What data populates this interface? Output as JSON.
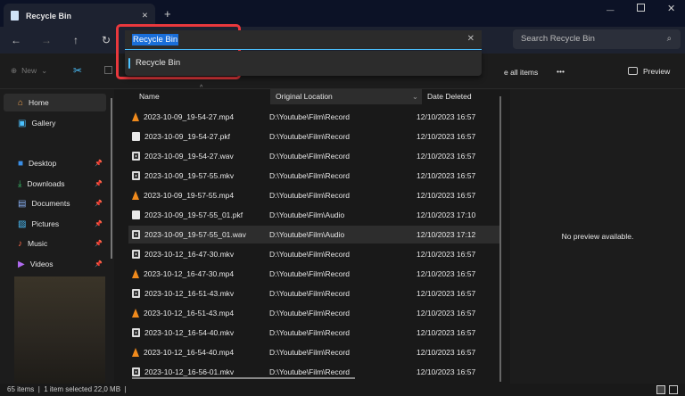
{
  "window": {
    "tab_title": "Recycle Bin",
    "new_tab": "+"
  },
  "address": {
    "value": "Recycle Bin",
    "suggestion": "Recycle Bin"
  },
  "search": {
    "placeholder": "Search Recycle Bin"
  },
  "toolbar": {
    "new_label": "New",
    "restore_all": "e all items",
    "more": "•••",
    "preview_label": "Preview"
  },
  "sidebar": {
    "items": [
      {
        "label": "Home",
        "icon": "home-icon",
        "pinned": false
      },
      {
        "label": "Gallery",
        "icon": "gallery-icon",
        "pinned": false
      },
      {
        "label": "Desktop",
        "icon": "desktop-icon",
        "pinned": true
      },
      {
        "label": "Downloads",
        "icon": "download-icon",
        "pinned": true
      },
      {
        "label": "Documents",
        "icon": "document-icon",
        "pinned": true
      },
      {
        "label": "Pictures",
        "icon": "pictures-icon",
        "pinned": true
      },
      {
        "label": "Music",
        "icon": "music-icon",
        "pinned": true
      },
      {
        "label": "Videos",
        "icon": "videos-icon",
        "pinned": true
      }
    ]
  },
  "columns": {
    "name": "Name",
    "location": "Original Location",
    "date": "Date Deleted"
  },
  "files": [
    {
      "name": "2023-10-09_19-54-27.mp4",
      "type": "vlc",
      "location": "D:\\Youtube\\Film\\Record",
      "date": "12/10/2023 16:57"
    },
    {
      "name": "2023-10-09_19-54-27.pkf",
      "type": "doc",
      "location": "D:\\Youtube\\Film\\Record",
      "date": "12/10/2023 16:57"
    },
    {
      "name": "2023-10-09_19-54-27.wav",
      "type": "media",
      "location": "D:\\Youtube\\Film\\Record",
      "date": "12/10/2023 16:57"
    },
    {
      "name": "2023-10-09_19-57-55.mkv",
      "type": "media",
      "location": "D:\\Youtube\\Film\\Record",
      "date": "12/10/2023 16:57"
    },
    {
      "name": "2023-10-09_19-57-55.mp4",
      "type": "vlc",
      "location": "D:\\Youtube\\Film\\Record",
      "date": "12/10/2023 16:57"
    },
    {
      "name": "2023-10-09_19-57-55_01.pkf",
      "type": "doc",
      "location": "D:\\Youtube\\Film\\Audio",
      "date": "12/10/2023 17:10"
    },
    {
      "name": "2023-10-09_19-57-55_01.wav",
      "type": "media",
      "location": "D:\\Youtube\\Film\\Audio",
      "date": "12/10/2023 17:12",
      "selected": true
    },
    {
      "name": "2023-10-12_16-47-30.mkv",
      "type": "media",
      "location": "D:\\Youtube\\Film\\Record",
      "date": "12/10/2023 16:57"
    },
    {
      "name": "2023-10-12_16-47-30.mp4",
      "type": "vlc",
      "location": "D:\\Youtube\\Film\\Record",
      "date": "12/10/2023 16:57"
    },
    {
      "name": "2023-10-12_16-51-43.mkv",
      "type": "media",
      "location": "D:\\Youtube\\Film\\Record",
      "date": "12/10/2023 16:57"
    },
    {
      "name": "2023-10-12_16-51-43.mp4",
      "type": "vlc",
      "location": "D:\\Youtube\\Film\\Record",
      "date": "12/10/2023 16:57"
    },
    {
      "name": "2023-10-12_16-54-40.mkv",
      "type": "media",
      "location": "D:\\Youtube\\Film\\Record",
      "date": "12/10/2023 16:57"
    },
    {
      "name": "2023-10-12_16-54-40.mp4",
      "type": "vlc",
      "location": "D:\\Youtube\\Film\\Record",
      "date": "12/10/2023 16:57"
    },
    {
      "name": "2023-10-12_16-56-01.mkv",
      "type": "media",
      "location": "D:\\Youtube\\Film\\Record",
      "date": "12/10/2023 16:57"
    }
  ],
  "preview": {
    "message": "No preview available."
  },
  "status": {
    "count": "65 items",
    "selection": "1 item selected  22,0 MB"
  },
  "colors": {
    "accent": "#4cc2ff",
    "highlight": "#e8383d",
    "selection": "#1a6ed8"
  }
}
